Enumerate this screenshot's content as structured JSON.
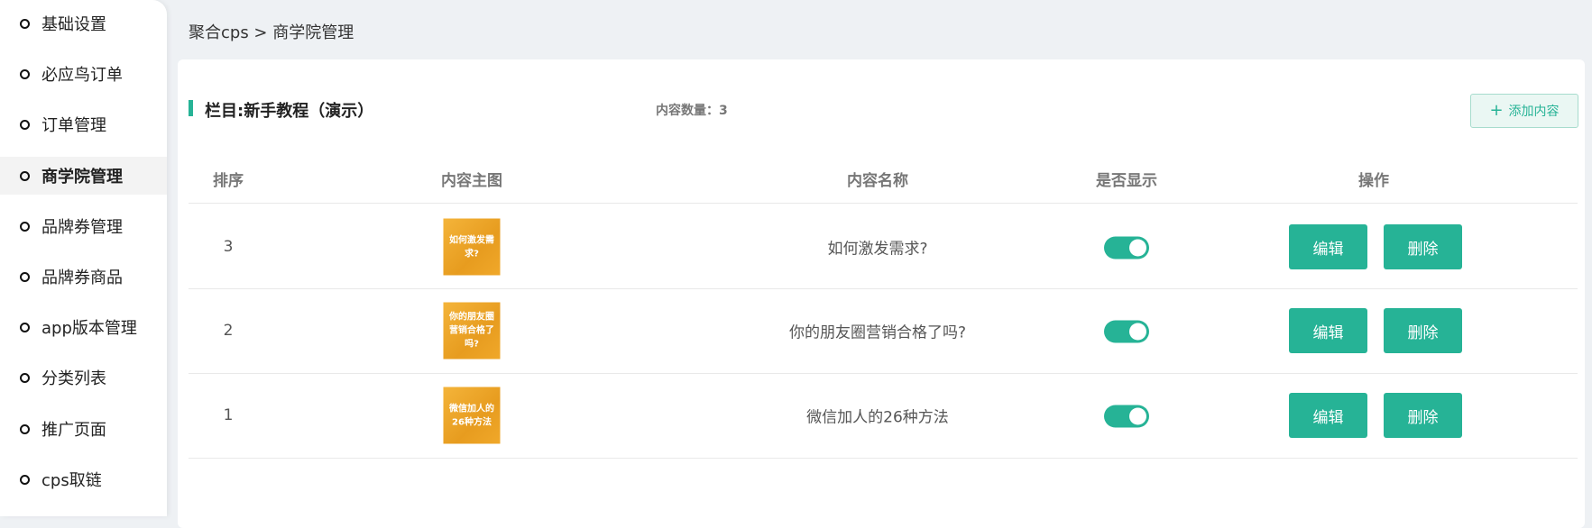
{
  "sidebar": {
    "items": [
      {
        "label": "基础设置",
        "active": false
      },
      {
        "label": "必应鸟订单",
        "active": false
      },
      {
        "label": "订单管理",
        "active": false
      },
      {
        "label": "商学院管理",
        "active": true
      },
      {
        "label": "品牌券管理",
        "active": false
      },
      {
        "label": "品牌券商品",
        "active": false
      },
      {
        "label": "app版本管理",
        "active": false
      },
      {
        "label": "分类列表",
        "active": false
      },
      {
        "label": "推广页面",
        "active": false
      },
      {
        "label": "cps取链",
        "active": false
      }
    ]
  },
  "breadcrumb": "聚合cps > 商学院管理",
  "section": {
    "title": "栏目:新手教程（演示）",
    "count_label": "内容数量：3",
    "add_button": "添加内容",
    "add_icon": "plus-icon"
  },
  "table": {
    "headers": [
      "排序",
      "内容主图",
      "内容名称",
      "是否显示",
      "操作"
    ],
    "rows": [
      {
        "order": "3",
        "thumb_text": "如何激发需求?",
        "name": "如何激发需求?",
        "visible": true
      },
      {
        "order": "2",
        "thumb_text": "你的朋友圈营销合格了吗?",
        "name": "你的朋友圈营销合格了吗?",
        "visible": true
      },
      {
        "order": "1",
        "thumb_text": "微信加人的26种方法",
        "name": "微信加人的26种方法",
        "visible": true
      }
    ],
    "edit_label": "编辑",
    "delete_label": "删除"
  },
  "colors": {
    "accent": "#26b396",
    "page_bg": "#eef1f4"
  }
}
